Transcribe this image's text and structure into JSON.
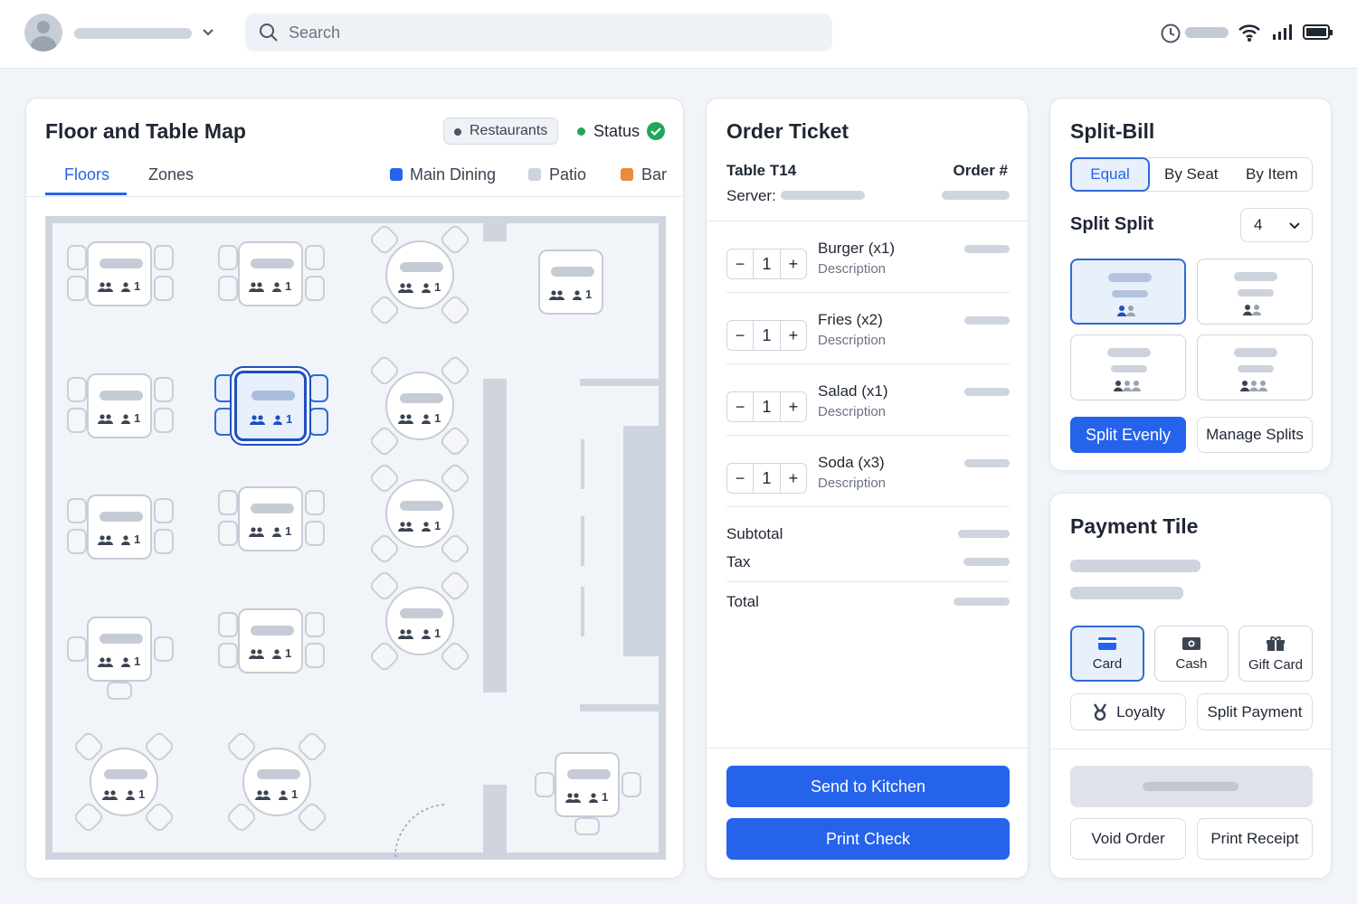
{
  "search": {
    "placeholder": "Search"
  },
  "floor": {
    "title": "Floor and Table Map",
    "filter_label": "Restaurants",
    "status_label": "Status",
    "tabs": [
      "Floors",
      "Zones"
    ],
    "zones": [
      {
        "label": "Main Dining",
        "color": "#2563eb"
      },
      {
        "label": "Patio",
        "color": "#cdd3dc"
      },
      {
        "label": "Bar",
        "color": "#ea8a3c"
      }
    ],
    "seat_count": "1"
  },
  "order": {
    "title": "Order Ticket",
    "table": "Table T14",
    "order_label": "Order #",
    "server_label": "Server:",
    "items": [
      {
        "name": "Burger (x1)",
        "desc": "Description",
        "qty": "1"
      },
      {
        "name": "Fries (x2)",
        "desc": "Description",
        "qty": "1"
      },
      {
        "name": "Salad (x1)",
        "desc": "Description",
        "qty": "1"
      },
      {
        "name": "Soda (x3)",
        "desc": "Description",
        "qty": "1"
      }
    ],
    "subtotal_label": "Subtotal",
    "tax_label": "Tax",
    "total_label": "Total",
    "send_label": "Send to Kitchen",
    "print_label": "Print Check"
  },
  "split": {
    "title": "Split-Bill",
    "modes": [
      "Equal",
      "By Seat",
      "By Item"
    ],
    "split_label": "Split Split",
    "split_value": "4",
    "even_label": "Split Evenly",
    "manage_label": "Manage Splits"
  },
  "payment": {
    "title": "Payment Tile",
    "methods": [
      "Card",
      "Cash",
      "Gift Card"
    ],
    "loyalty_label": "Loyalty",
    "split_payment_label": "Split Payment",
    "void_label": "Void Order",
    "receipt_label": "Print Receipt"
  }
}
